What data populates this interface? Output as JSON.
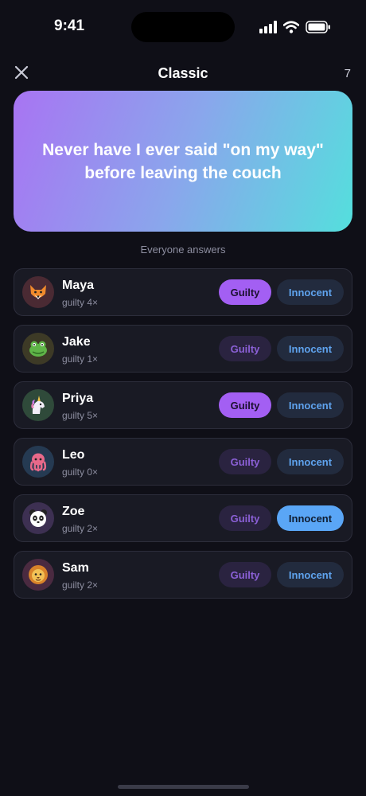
{
  "status": {
    "time": "9:41"
  },
  "header": {
    "title": "Classic",
    "counter": "7"
  },
  "prompt": {
    "text": "Never have I ever said \"on my way\" before leaving the couch"
  },
  "section_label": "Everyone answers",
  "buttons": {
    "guilty_label": "Guilty",
    "innocent_label": "Innocent"
  },
  "players": [
    {
      "name": "Maya",
      "count": "guilty 4×",
      "avatar_icon": "fox-icon",
      "avatar_bg": "#4a2a33",
      "selection": "guilty"
    },
    {
      "name": "Jake",
      "count": "guilty 1×",
      "avatar_icon": "frog-icon",
      "avatar_bg": "#3d3a26",
      "selection": "none"
    },
    {
      "name": "Priya",
      "count": "guilty 5×",
      "avatar_icon": "unicorn-icon",
      "avatar_bg": "#2f4a3a",
      "selection": "guilty"
    },
    {
      "name": "Leo",
      "count": "guilty 0×",
      "avatar_icon": "octopus-icon",
      "avatar_bg": "#253a52",
      "selection": "none"
    },
    {
      "name": "Zoe",
      "count": "guilty 2×",
      "avatar_icon": "panda-icon",
      "avatar_bg": "#3d3052",
      "selection": "innocent"
    },
    {
      "name": "Sam",
      "count": "guilty 2×",
      "avatar_icon": "lion-icon",
      "avatar_bg": "#4a2a40",
      "selection": "none"
    }
  ],
  "colors": {
    "background": "#0f0f17",
    "guilty_active": "#a35ff3",
    "innocent_active": "#5aa6f6",
    "card_gradient_start": "#a874f3",
    "card_gradient_end": "#54dfdd"
  }
}
